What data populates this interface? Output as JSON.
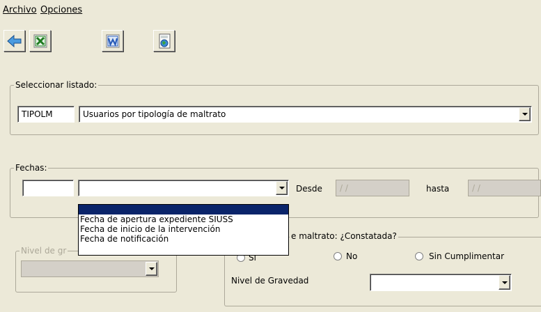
{
  "menu": [
    {
      "label": "Archivo"
    },
    {
      "label": "Opciones"
    }
  ],
  "toolbar": [
    {
      "icon": "back-arrow-icon"
    },
    {
      "icon": "excel-icon"
    },
    {
      "icon": "word-icon"
    },
    {
      "icon": "web-page-icon"
    }
  ],
  "listado": {
    "title": "Seleccionar listado:",
    "code": "TIPOLM",
    "selected": "Usuarios por tipología de maltrato"
  },
  "fechas": {
    "title": "Fechas:",
    "code": "",
    "selected": "",
    "desde_label": "Desde",
    "desde_value": "/ /",
    "hasta_label": "hasta",
    "hasta_value": "/ /",
    "options": [
      "",
      "Fecha de apertura expediente SIUSS",
      "Fecha de inicio de la intervención",
      "Fecha de notificación"
    ]
  },
  "nivel_left": {
    "title": "Nivel de gr"
  },
  "constatada": {
    "title": "e maltrato: ¿Constatada?",
    "radio_si": "Sí",
    "radio_no": "No",
    "radio_sin": "Sin Cumplimentar",
    "nivel_label": "Nivel de Gravedad"
  },
  "colors": {
    "background": "#ECE9D8",
    "selection": "#0A246A",
    "excel_green": "#1E7B1E",
    "word_blue": "#2A5CB8"
  }
}
